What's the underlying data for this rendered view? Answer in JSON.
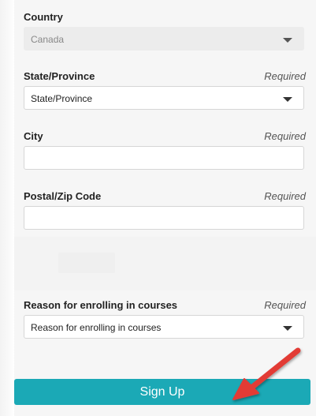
{
  "country": {
    "label": "Country",
    "value": "Canada"
  },
  "state": {
    "label": "State/Province",
    "required": "Required",
    "value": "State/Province"
  },
  "city": {
    "label": "City",
    "required": "Required",
    "value": ""
  },
  "postal": {
    "label": "Postal/Zip Code",
    "required": "Required",
    "value": ""
  },
  "reason": {
    "label": "Reason for enrolling in courses",
    "required": "Required",
    "value": "Reason for enrolling in courses"
  },
  "signup": {
    "label": "Sign Up"
  },
  "colors": {
    "accent": "#1ba9b6",
    "annotation_arrow": "#e23a35"
  },
  "icons": [
    "chevron-down-icon",
    "annotation-arrow-icon"
  ]
}
